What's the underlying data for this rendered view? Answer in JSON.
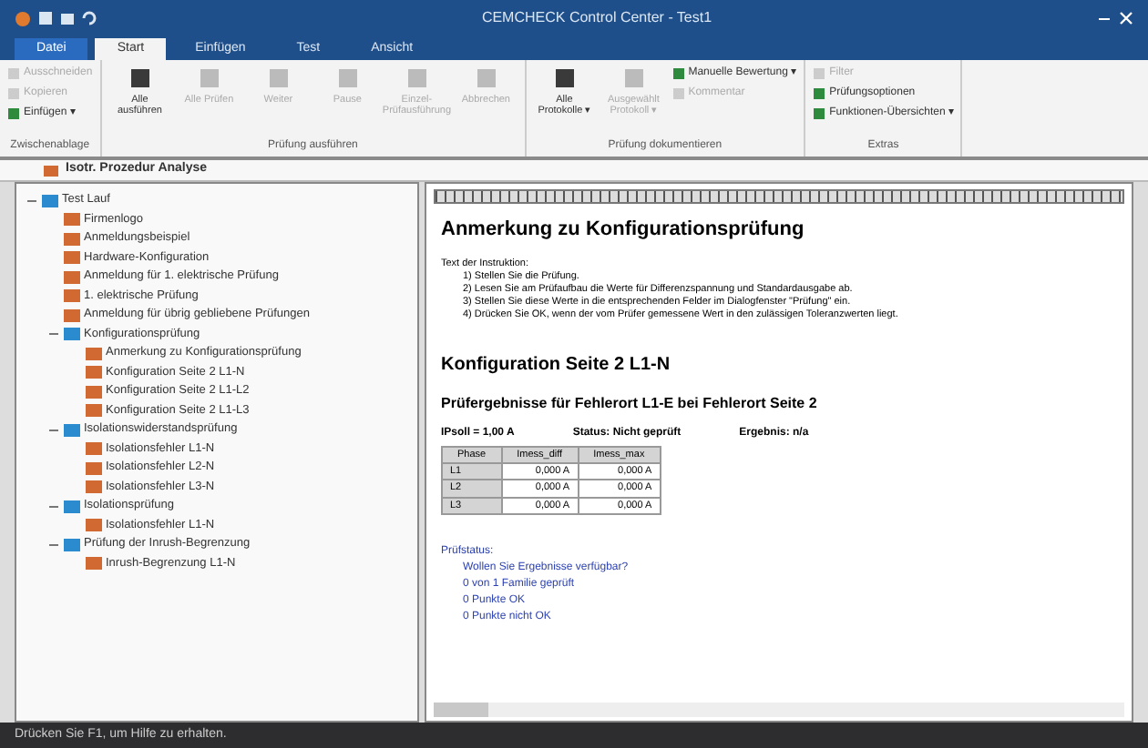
{
  "window": {
    "title": "CEMCHECK Control Center - Test1"
  },
  "menu_tabs": [
    {
      "label": "Datei",
      "selected": false,
      "kind": "file"
    },
    {
      "label": "Start",
      "selected": true,
      "kind": "tab"
    },
    {
      "label": "Einfügen",
      "selected": false,
      "kind": "tab"
    },
    {
      "label": "Test",
      "selected": false,
      "kind": "tab"
    },
    {
      "label": "Ansicht",
      "selected": false,
      "kind": "tab"
    }
  ],
  "ribbon": {
    "groups": [
      {
        "title": "Zwischenablage",
        "items": [
          {
            "label": "Ausschneiden",
            "kind": "small",
            "disabled": true
          },
          {
            "label": "Kopieren",
            "kind": "small",
            "disabled": true
          },
          {
            "label": "Einfügen ▾",
            "kind": "small",
            "disabled": false
          }
        ]
      },
      {
        "title": "Prüfung ausführen",
        "items": [
          {
            "label": "Alle ausführen",
            "kind": "large",
            "disabled": false
          },
          {
            "label": "Alle Prüfen",
            "kind": "large",
            "disabled": true
          },
          {
            "label": "Weiter",
            "kind": "large",
            "disabled": true
          },
          {
            "label": "Pause",
            "kind": "large",
            "disabled": true
          },
          {
            "label": "Einzel-Prüfausführung",
            "kind": "large",
            "disabled": true
          },
          {
            "label": "Abbrechen",
            "kind": "large",
            "disabled": true
          }
        ]
      },
      {
        "title": "Prüfung dokumentieren",
        "items": [
          {
            "label": "Alle Protokolle ▾",
            "kind": "large",
            "disabled": false
          },
          {
            "label": "Ausgewählt Protokoll ▾",
            "kind": "large",
            "disabled": true
          },
          {
            "label": "Manuelle Bewertung ▾",
            "kind": "small",
            "disabled": false
          },
          {
            "label": "Kommentar",
            "kind": "small",
            "disabled": true
          }
        ]
      },
      {
        "title": "Extras",
        "items": [
          {
            "label": "Filter",
            "kind": "small",
            "disabled": true
          },
          {
            "label": "Prüfungsoptionen",
            "kind": "small",
            "disabled": false
          },
          {
            "label": "Funktionen-Übersichten ▾",
            "kind": "small",
            "disabled": false
          }
        ]
      }
    ]
  },
  "document_tab": {
    "label": "Isotr. Prozedur Analyse"
  },
  "tree": [
    {
      "label": "Test Lauf",
      "expanded": true,
      "children": [
        {
          "label": "Firmenlogo"
        },
        {
          "label": "Anmeldungsbeispiel"
        },
        {
          "label": "Hardware-Konfiguration"
        },
        {
          "label": "Anmeldung für 1. elektrische Prüfung"
        },
        {
          "label": "1. elektrische Prüfung"
        },
        {
          "label": "Anmeldung für übrig gebliebene Prüfungen"
        },
        {
          "label": "Konfigurationsprüfung",
          "expanded": true,
          "children": [
            {
              "label": "Anmerkung zu Konfigurationsprüfung"
            },
            {
              "label": "Konfiguration Seite 2 L1-N"
            },
            {
              "label": "Konfiguration Seite 2 L1-L2"
            },
            {
              "label": "Konfiguration Seite 2 L1-L3"
            }
          ]
        },
        {
          "label": "Isolationswiderstandsprüfung",
          "expanded": true,
          "children": [
            {
              "label": "Isolationsfehler L1-N"
            },
            {
              "label": "Isolationsfehler L2-N"
            },
            {
              "label": "Isolationsfehler L3-N"
            }
          ]
        },
        {
          "label": "Isolationsprüfung",
          "expanded": true,
          "children": [
            {
              "label": "Isolationsfehler L1-N"
            }
          ]
        },
        {
          "label": "Prüfung der Inrush-Begrenzung",
          "expanded": true,
          "children": [
            {
              "label": "Inrush-Begrenzung L1-N"
            }
          ]
        }
      ]
    }
  ],
  "report": {
    "heading": "Anmerkung zu Konfigurationsprüfung",
    "instruction_title": "Text der Instruktion:",
    "instructions": [
      "1) Stellen Sie die Prüfung.",
      "2) Lesen Sie am Prüfaufbau die Werte für Differenzspannung und Standardausgabe ab.",
      "3) Stellen Sie diese Werte in die entsprechenden Felder im Dialogfenster \"Prüfung\" ein.",
      "4) Drücken Sie OK, wenn der vom Prüfer gemessene Wert in den zulässigen Toleranzwerten liegt."
    ],
    "section_heading": "Konfiguration Seite 2 L1-N",
    "subheading": "Prüfergebnisse für Fehlerort L1-E bei Fehlerort Seite 2",
    "summary": [
      "IPsoll = 1,00 A",
      "Status: Nicht geprüft",
      "Ergebnis: n/a"
    ],
    "table": {
      "columns": [
        "Phase",
        "Imess_diff",
        "Imess_max"
      ],
      "rows": [
        [
          "L1",
          "0,000 A",
          "0,000 A"
        ],
        [
          "L2",
          "0,000 A",
          "0,000 A"
        ],
        [
          "L3",
          "0,000 A",
          "0,000 A"
        ]
      ]
    },
    "status_title": "Prüfstatus:",
    "status_question": "Wollen Sie Ergebnisse verfügbar?",
    "status_lines": [
      "0 von 1 Familie geprüft",
      "0 Punkte OK",
      "0 Punkte nicht OK"
    ]
  },
  "status_bar": {
    "text": "Drücken Sie F1, um Hilfe zu erhalten."
  }
}
